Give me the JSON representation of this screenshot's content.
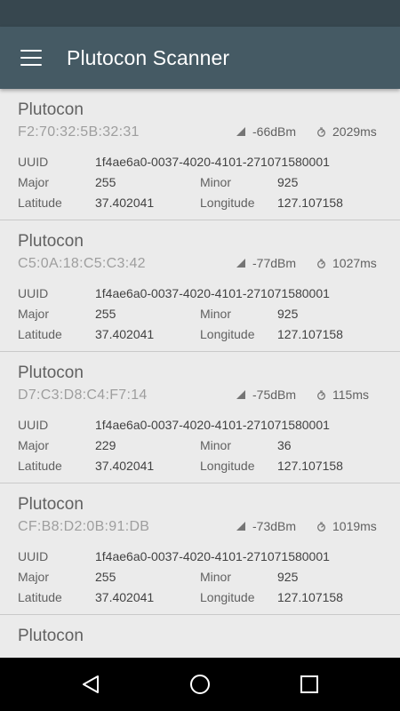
{
  "app_bar": {
    "title": "Plutocon Scanner"
  },
  "labels": {
    "uuid": "UUID",
    "major": "Major",
    "minor": "Minor",
    "latitude": "Latitude",
    "longitude": "Longitude"
  },
  "beacons": [
    {
      "name": "Plutocon",
      "mac": "F2:70:32:5B:32:31",
      "rssi": "-66dBm",
      "interval": "2029ms",
      "uuid": "1f4ae6a0-0037-4020-4101-271071580001",
      "major": "255",
      "minor": "925",
      "latitude": "37.402041",
      "longitude": "127.107158"
    },
    {
      "name": "Plutocon",
      "mac": "C5:0A:18:C5:C3:42",
      "rssi": "-77dBm",
      "interval": "1027ms",
      "uuid": "1f4ae6a0-0037-4020-4101-271071580001",
      "major": "255",
      "minor": "925",
      "latitude": "37.402041",
      "longitude": "127.107158"
    },
    {
      "name": "Plutocon",
      "mac": "D7:C3:D8:C4:F7:14",
      "rssi": "-75dBm",
      "interval": "115ms",
      "uuid": "1f4ae6a0-0037-4020-4101-271071580001",
      "major": "229",
      "minor": "36",
      "latitude": "37.402041",
      "longitude": "127.107158"
    },
    {
      "name": "Plutocon",
      "mac": "CF:B8:D2:0B:91:DB",
      "rssi": "-73dBm",
      "interval": "1019ms",
      "uuid": "1f4ae6a0-0037-4020-4101-271071580001",
      "major": "255",
      "minor": "925",
      "latitude": "37.402041",
      "longitude": "127.107158"
    },
    {
      "name": "Plutocon",
      "mac": "",
      "rssi": "",
      "interval": "",
      "uuid": "",
      "major": "",
      "minor": "",
      "latitude": "",
      "longitude": ""
    }
  ],
  "icons": {
    "menu": "menu-icon",
    "signal": "signal-strength-icon",
    "interval": "timer-icon",
    "back": "back-icon",
    "home": "home-icon",
    "recents": "recents-icon"
  },
  "colors": {
    "status_bar": "#37474f",
    "app_bar": "#455a64",
    "background": "#ebebeb"
  }
}
